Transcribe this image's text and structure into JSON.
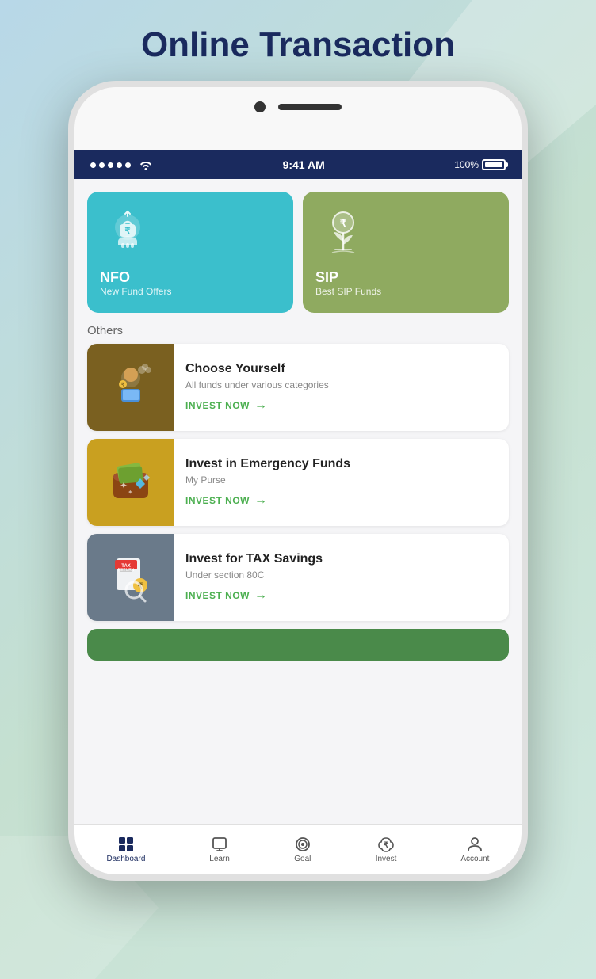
{
  "page": {
    "title": "Online Transaction",
    "background_colors": [
      "#b8d8e8",
      "#c5e0d0"
    ]
  },
  "status_bar": {
    "time": "9:41 AM",
    "battery": "100%",
    "signal_dots": 5
  },
  "top_cards": [
    {
      "id": "nfo",
      "title": "NFO",
      "subtitle": "New Fund Offers",
      "bg_color": "#3bbfcc"
    },
    {
      "id": "sip",
      "title": "SIP",
      "subtitle": "Best SIP Funds",
      "bg_color": "#8faa60"
    }
  ],
  "others_label": "Others",
  "list_items": [
    {
      "id": "choose-yourself",
      "title": "Choose Yourself",
      "desc": "All funds under various categories",
      "cta": "INVEST NOW",
      "bg_color": "#7a6020",
      "emoji": "🧑‍💼"
    },
    {
      "id": "emergency-funds",
      "title": "Invest in Emergency Funds",
      "desc": "My Purse",
      "cta": "INVEST NOW",
      "bg_color": "#c9a020",
      "emoji": "👜"
    },
    {
      "id": "tax-savings",
      "title": "Invest for TAX Savings",
      "desc": "Under section 80C",
      "cta": "INVEST NOW",
      "bg_color": "#6a7a8a",
      "emoji": "📋"
    }
  ],
  "bottom_nav": [
    {
      "id": "dashboard",
      "label": "Dashboard",
      "icon": "grid",
      "active": true
    },
    {
      "id": "learn",
      "label": "Learn",
      "icon": "monitor",
      "active": false
    },
    {
      "id": "goal",
      "label": "Goal",
      "icon": "target",
      "active": false
    },
    {
      "id": "invest",
      "label": "Invest",
      "icon": "piggy",
      "active": false
    },
    {
      "id": "account",
      "label": "Account",
      "icon": "person",
      "active": false
    }
  ],
  "partial_card_color": "#4a8a4a"
}
